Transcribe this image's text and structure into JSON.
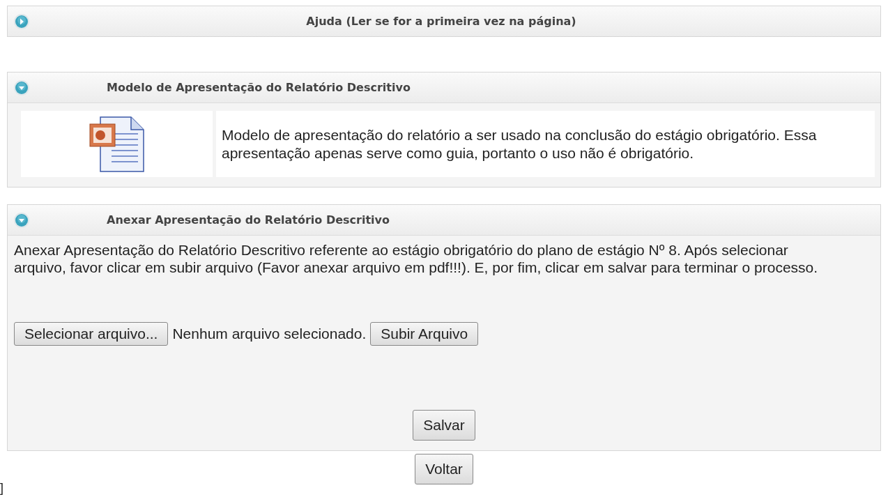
{
  "panels": [
    {
      "kind": "help",
      "title": "Ajuda (Ler se for a primeira vez na página)",
      "expanded": false
    },
    {
      "kind": "template",
      "title": "Modelo de Apresentação do Relatório Descritivo",
      "expanded": true,
      "description": "Modelo de apresentação do relatório a ser usado na conclusão do estágio obrigatório. Essa apresentação apenas serve como guia, portanto o uso não é obrigatório."
    },
    {
      "kind": "upload",
      "title": "Anexar Apresentação do Relatório Descritivo",
      "expanded": true,
      "instructions": "Anexar Apresentação do Relatório Descritivo referente ao estágio obrigatório do plano de estágio Nº 8. Após selecionar arquivo, favor clicar em subir arquivo (Favor anexar arquivo em pdf!!!). E, por fim, clicar em salvar para terminar o processo.",
      "file_button": "Selecionar arquivo...",
      "file_status": "Nenhum arquivo selecionado.",
      "upload_button": "Subir Arquivo",
      "save_button": "Salvar"
    }
  ],
  "stray_mark": "]",
  "back_button": "Voltar"
}
